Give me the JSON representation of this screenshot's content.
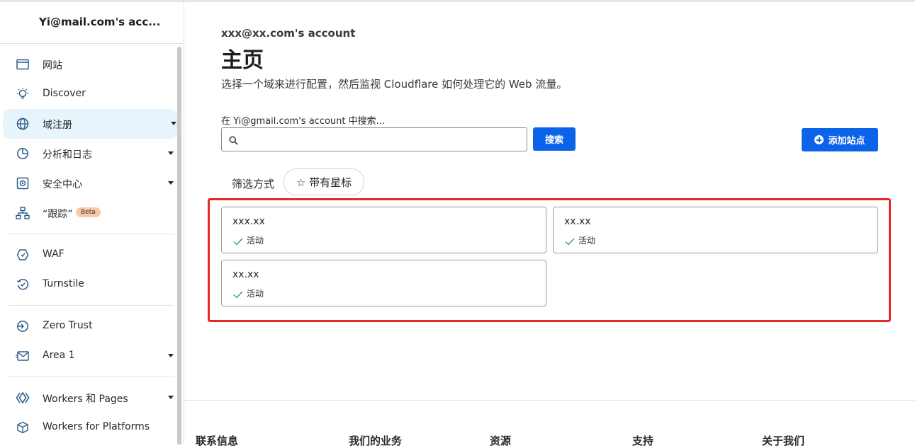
{
  "sidebar": {
    "account_name": "Yi@mail.com's acc...",
    "items": [
      {
        "label": "网站",
        "icon": "browser-window-icon",
        "caret": false
      },
      {
        "label": "Discover",
        "icon": "lightbulb-icon",
        "caret": false
      },
      {
        "label": "域注册",
        "icon": "globe-icon",
        "caret": true,
        "active": true
      },
      {
        "label": "分析和日志",
        "icon": "pie-chart-icon",
        "caret": true
      },
      {
        "label": "安全中心",
        "icon": "security-center-icon",
        "caret": true
      },
      {
        "label": "“跟踪”",
        "icon": "sitemap-icon",
        "caret": false,
        "badge": "Beta"
      },
      {
        "label": "WAF",
        "icon": "shield-icon",
        "caret": false
      },
      {
        "label": "Turnstile",
        "icon": "turnstile-icon",
        "caret": false
      },
      {
        "label": "Zero Trust",
        "icon": "zero-trust-icon",
        "caret": false
      },
      {
        "label": "Area 1",
        "icon": "envelope-icon",
        "caret": true
      },
      {
        "label": "Workers 和 Pages",
        "icon": "workers-icon",
        "caret": true
      },
      {
        "label": "Workers for Platforms",
        "icon": "cube-icon",
        "caret": false
      }
    ]
  },
  "main": {
    "account_title": "xxx@xx.com's account",
    "page_title": "主页",
    "subtitle": "选择一个域来进行配置，然后监视 Cloudflare 如何处理它的 Web 流量。",
    "search_label": "在 Yi@gmail.com's account 中搜索...",
    "search_value": "",
    "search_button": "搜索",
    "add_site_button": "添加站点",
    "filter_label": "筛选方式",
    "filter_chip": "☆ 带有星标",
    "sites": [
      {
        "domain": "xxx.xx",
        "status": "活动"
      },
      {
        "domain": "xx.xx",
        "status": "活动"
      },
      {
        "domain": "xx.xx",
        "status": "活动"
      }
    ]
  },
  "footer": {
    "columns": [
      "联系信息",
      "我们的业务",
      "资源",
      "支持",
      "关于我们"
    ]
  },
  "colors": {
    "primary_button": "#0b63e9",
    "highlight_border": "#e8272b",
    "active_nav_bg": "#e8f4fb",
    "status_check": "#2e9d4a"
  }
}
